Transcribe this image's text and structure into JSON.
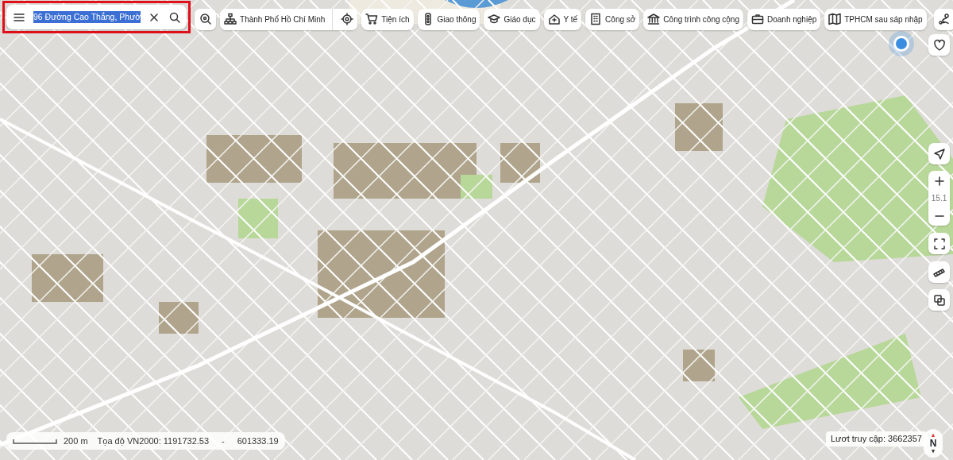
{
  "search": {
    "value": "96 Đường Cao Thắng, Phườ",
    "text_selected": true,
    "highlighted": true
  },
  "region": {
    "label": "Thành Phố Hồ Chí Minh"
  },
  "categories": [
    {
      "label": "Tiện ích",
      "kind": "cart"
    },
    {
      "label": "Giao thông",
      "kind": "traffic"
    },
    {
      "label": "Giáo dục",
      "kind": "cap"
    },
    {
      "label": "Y tế",
      "kind": "house"
    },
    {
      "label": "Công sở",
      "kind": "building"
    },
    {
      "label": "Công trình công cộng",
      "kind": "bank"
    },
    {
      "label": "Doanh nghiệp",
      "kind": "briefcase"
    },
    {
      "label": "TPHCM sau sáp nhập",
      "kind": "map"
    }
  ],
  "zoom": {
    "level_text": "15.1"
  },
  "scale": {
    "label": "200 m"
  },
  "coordinates": {
    "label": "Tọa độ VN2000: 1191732.53",
    "separator": "-",
    "value": "601333.19"
  },
  "visits": {
    "label": "Lươt truy cập: 3662357"
  },
  "compass": {
    "label": "N"
  }
}
